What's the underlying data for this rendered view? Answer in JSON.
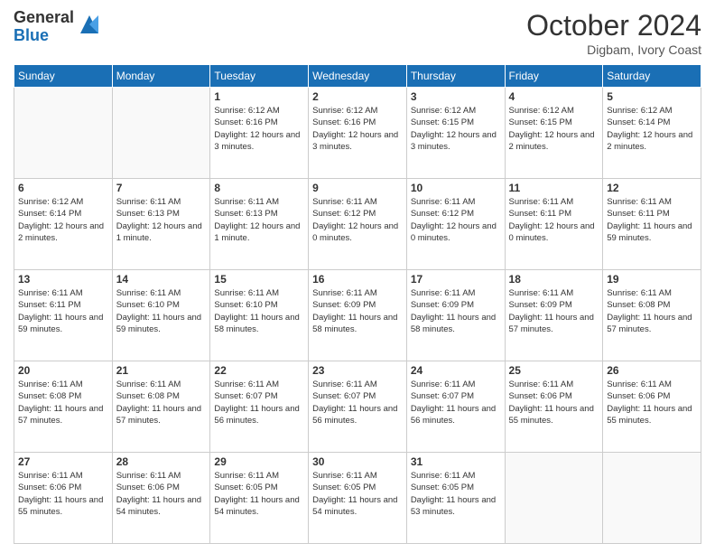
{
  "header": {
    "logo_general": "General",
    "logo_blue": "Blue",
    "month_title": "October 2024",
    "location": "Digbam, Ivory Coast"
  },
  "weekdays": [
    "Sunday",
    "Monday",
    "Tuesday",
    "Wednesday",
    "Thursday",
    "Friday",
    "Saturday"
  ],
  "rows": [
    [
      {
        "day": "",
        "sunrise": "",
        "sunset": "",
        "daylight": "",
        "empty": true
      },
      {
        "day": "",
        "sunrise": "",
        "sunset": "",
        "daylight": "",
        "empty": true
      },
      {
        "day": "1",
        "sunrise": "Sunrise: 6:12 AM",
        "sunset": "Sunset: 6:16 PM",
        "daylight": "Daylight: 12 hours and 3 minutes."
      },
      {
        "day": "2",
        "sunrise": "Sunrise: 6:12 AM",
        "sunset": "Sunset: 6:16 PM",
        "daylight": "Daylight: 12 hours and 3 minutes."
      },
      {
        "day": "3",
        "sunrise": "Sunrise: 6:12 AM",
        "sunset": "Sunset: 6:15 PM",
        "daylight": "Daylight: 12 hours and 3 minutes."
      },
      {
        "day": "4",
        "sunrise": "Sunrise: 6:12 AM",
        "sunset": "Sunset: 6:15 PM",
        "daylight": "Daylight: 12 hours and 2 minutes."
      },
      {
        "day": "5",
        "sunrise": "Sunrise: 6:12 AM",
        "sunset": "Sunset: 6:14 PM",
        "daylight": "Daylight: 12 hours and 2 minutes."
      }
    ],
    [
      {
        "day": "6",
        "sunrise": "Sunrise: 6:12 AM",
        "sunset": "Sunset: 6:14 PM",
        "daylight": "Daylight: 12 hours and 2 minutes."
      },
      {
        "day": "7",
        "sunrise": "Sunrise: 6:11 AM",
        "sunset": "Sunset: 6:13 PM",
        "daylight": "Daylight: 12 hours and 1 minute."
      },
      {
        "day": "8",
        "sunrise": "Sunrise: 6:11 AM",
        "sunset": "Sunset: 6:13 PM",
        "daylight": "Daylight: 12 hours and 1 minute."
      },
      {
        "day": "9",
        "sunrise": "Sunrise: 6:11 AM",
        "sunset": "Sunset: 6:12 PM",
        "daylight": "Daylight: 12 hours and 0 minutes."
      },
      {
        "day": "10",
        "sunrise": "Sunrise: 6:11 AM",
        "sunset": "Sunset: 6:12 PM",
        "daylight": "Daylight: 12 hours and 0 minutes."
      },
      {
        "day": "11",
        "sunrise": "Sunrise: 6:11 AM",
        "sunset": "Sunset: 6:11 PM",
        "daylight": "Daylight: 12 hours and 0 minutes."
      },
      {
        "day": "12",
        "sunrise": "Sunrise: 6:11 AM",
        "sunset": "Sunset: 6:11 PM",
        "daylight": "Daylight: 11 hours and 59 minutes."
      }
    ],
    [
      {
        "day": "13",
        "sunrise": "Sunrise: 6:11 AM",
        "sunset": "Sunset: 6:11 PM",
        "daylight": "Daylight: 11 hours and 59 minutes."
      },
      {
        "day": "14",
        "sunrise": "Sunrise: 6:11 AM",
        "sunset": "Sunset: 6:10 PM",
        "daylight": "Daylight: 11 hours and 59 minutes."
      },
      {
        "day": "15",
        "sunrise": "Sunrise: 6:11 AM",
        "sunset": "Sunset: 6:10 PM",
        "daylight": "Daylight: 11 hours and 58 minutes."
      },
      {
        "day": "16",
        "sunrise": "Sunrise: 6:11 AM",
        "sunset": "Sunset: 6:09 PM",
        "daylight": "Daylight: 11 hours and 58 minutes."
      },
      {
        "day": "17",
        "sunrise": "Sunrise: 6:11 AM",
        "sunset": "Sunset: 6:09 PM",
        "daylight": "Daylight: 11 hours and 58 minutes."
      },
      {
        "day": "18",
        "sunrise": "Sunrise: 6:11 AM",
        "sunset": "Sunset: 6:09 PM",
        "daylight": "Daylight: 11 hours and 57 minutes."
      },
      {
        "day": "19",
        "sunrise": "Sunrise: 6:11 AM",
        "sunset": "Sunset: 6:08 PM",
        "daylight": "Daylight: 11 hours and 57 minutes."
      }
    ],
    [
      {
        "day": "20",
        "sunrise": "Sunrise: 6:11 AM",
        "sunset": "Sunset: 6:08 PM",
        "daylight": "Daylight: 11 hours and 57 minutes."
      },
      {
        "day": "21",
        "sunrise": "Sunrise: 6:11 AM",
        "sunset": "Sunset: 6:08 PM",
        "daylight": "Daylight: 11 hours and 57 minutes."
      },
      {
        "day": "22",
        "sunrise": "Sunrise: 6:11 AM",
        "sunset": "Sunset: 6:07 PM",
        "daylight": "Daylight: 11 hours and 56 minutes."
      },
      {
        "day": "23",
        "sunrise": "Sunrise: 6:11 AM",
        "sunset": "Sunset: 6:07 PM",
        "daylight": "Daylight: 11 hours and 56 minutes."
      },
      {
        "day": "24",
        "sunrise": "Sunrise: 6:11 AM",
        "sunset": "Sunset: 6:07 PM",
        "daylight": "Daylight: 11 hours and 56 minutes."
      },
      {
        "day": "25",
        "sunrise": "Sunrise: 6:11 AM",
        "sunset": "Sunset: 6:06 PM",
        "daylight": "Daylight: 11 hours and 55 minutes."
      },
      {
        "day": "26",
        "sunrise": "Sunrise: 6:11 AM",
        "sunset": "Sunset: 6:06 PM",
        "daylight": "Daylight: 11 hours and 55 minutes."
      }
    ],
    [
      {
        "day": "27",
        "sunrise": "Sunrise: 6:11 AM",
        "sunset": "Sunset: 6:06 PM",
        "daylight": "Daylight: 11 hours and 55 minutes."
      },
      {
        "day": "28",
        "sunrise": "Sunrise: 6:11 AM",
        "sunset": "Sunset: 6:06 PM",
        "daylight": "Daylight: 11 hours and 54 minutes."
      },
      {
        "day": "29",
        "sunrise": "Sunrise: 6:11 AM",
        "sunset": "Sunset: 6:05 PM",
        "daylight": "Daylight: 11 hours and 54 minutes."
      },
      {
        "day": "30",
        "sunrise": "Sunrise: 6:11 AM",
        "sunset": "Sunset: 6:05 PM",
        "daylight": "Daylight: 11 hours and 54 minutes."
      },
      {
        "day": "31",
        "sunrise": "Sunrise: 6:11 AM",
        "sunset": "Sunset: 6:05 PM",
        "daylight": "Daylight: 11 hours and 53 minutes."
      },
      {
        "day": "",
        "sunrise": "",
        "sunset": "",
        "daylight": "",
        "empty": true
      },
      {
        "day": "",
        "sunrise": "",
        "sunset": "",
        "daylight": "",
        "empty": true
      }
    ]
  ]
}
